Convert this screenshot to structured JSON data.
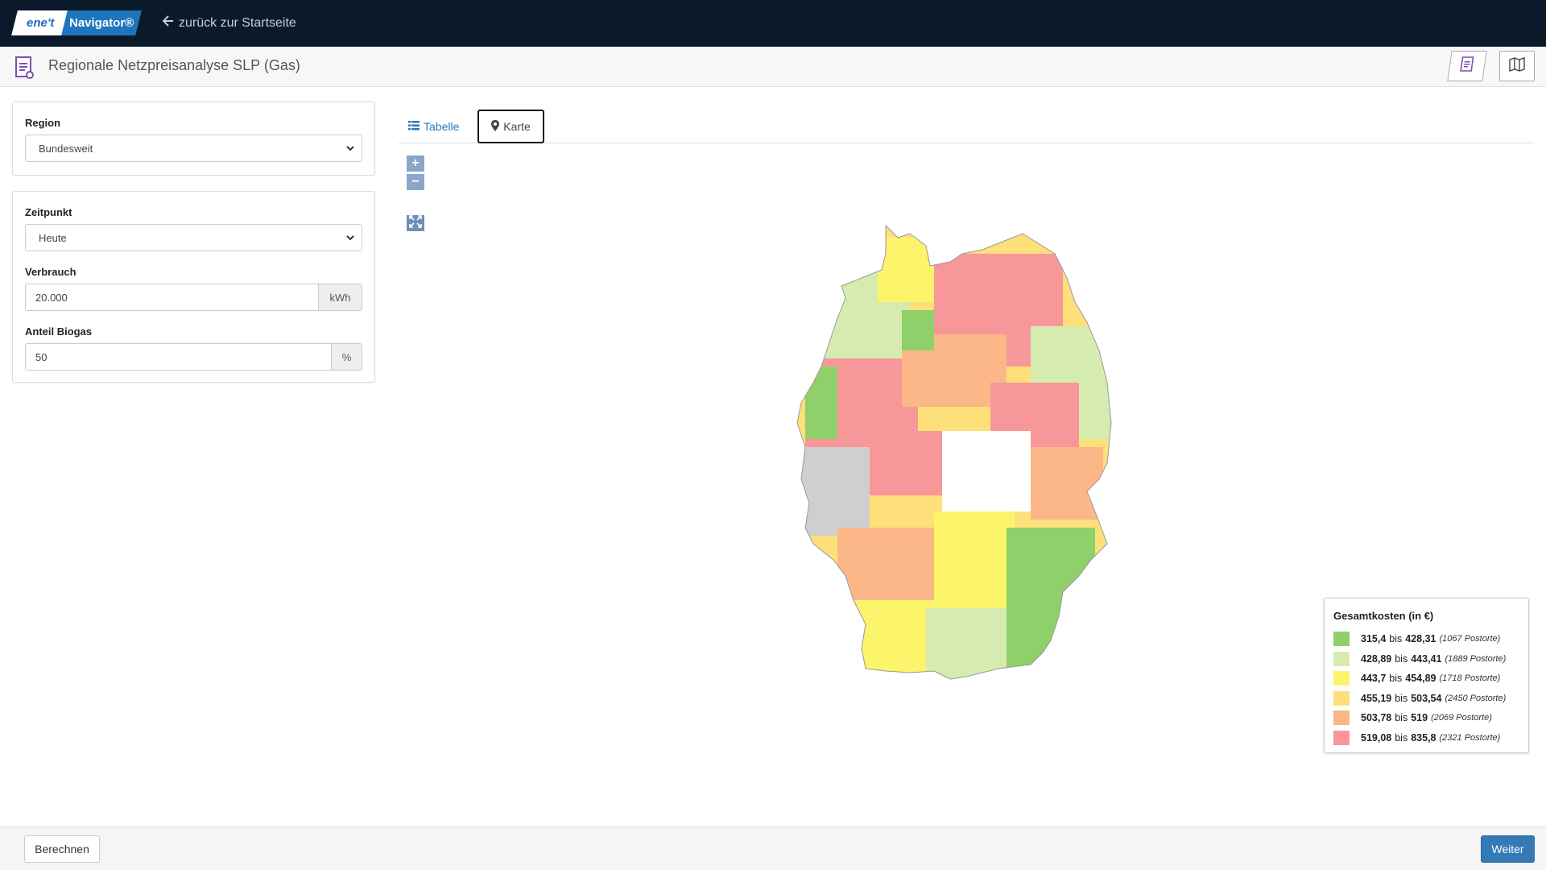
{
  "nav": {
    "logo_left": "ene't",
    "logo_right": "Navigator®",
    "back_label": "zurück zur Startseite"
  },
  "header": {
    "title": "Regionale Netzpreisanalyse SLP (Gas)"
  },
  "form": {
    "region_label": "Region",
    "region_value": "Bundesweit",
    "zeitpunkt_label": "Zeitpunkt",
    "zeitpunkt_value": "Heute",
    "verbrauch_label": "Verbrauch",
    "verbrauch_value": "20.000",
    "verbrauch_unit": "kWh",
    "biogas_label": "Anteil Biogas",
    "biogas_value": "50",
    "biogas_unit": "%"
  },
  "tabs": {
    "tabelle": "Tabelle",
    "karte": "Karte"
  },
  "map": {
    "zoom_in": "+",
    "zoom_out": "−"
  },
  "legend": {
    "title": "Gesamtkosten (in €)",
    "items": [
      {
        "from": "315,4",
        "sep": "bis",
        "to": "428,31",
        "count": "(1067 Postorte)",
        "color": "#8fd06a"
      },
      {
        "from": "428,89",
        "sep": "bis",
        "to": "443,41",
        "count": "(1889 Postorte)",
        "color": "#d6ebb0"
      },
      {
        "from": "443,7",
        "sep": "bis",
        "to": "454,89",
        "count": "(1718 Postorte)",
        "color": "#fcf46a"
      },
      {
        "from": "455,19",
        "sep": "bis",
        "to": "503,54",
        "count": "(2450 Postorte)",
        "color": "#fde07a"
      },
      {
        "from": "503,78",
        "sep": "bis",
        "to": "519",
        "count": "(2069 Postorte)",
        "color": "#fbb787"
      },
      {
        "from": "519,08",
        "sep": "bis",
        "to": "835,8",
        "count": "(2321 Postorte)",
        "color": "#f7979a"
      }
    ]
  },
  "footer": {
    "calc_label": "Berechnen",
    "next_label": "Weiter"
  }
}
